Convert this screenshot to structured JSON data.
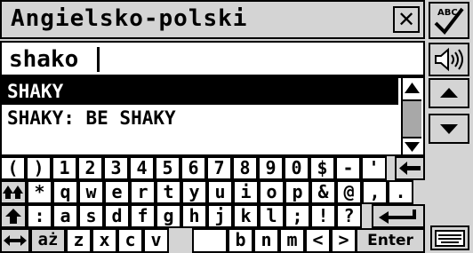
{
  "title": "Angielsko-polski",
  "search": {
    "value": "shako"
  },
  "results": [
    "SHAKY",
    "SHAKY: BE SHAKY"
  ],
  "keyboard": {
    "row1": [
      "(",
      ")",
      "1",
      "2",
      "3",
      "4",
      "5",
      "6",
      "7",
      "8",
      "9",
      "0",
      "$",
      "-",
      "'"
    ],
    "row2": [
      "*",
      "q",
      "w",
      "e",
      "r",
      "t",
      "y",
      "u",
      "i",
      "o",
      "p",
      "&",
      "@",
      ",",
      "."
    ],
    "row3": [
      ":",
      "a",
      "s",
      "d",
      "f",
      "g",
      "h",
      "j",
      "k",
      "l",
      ";",
      "!",
      "?"
    ],
    "row4": [
      "z",
      "x",
      "c",
      "v",
      "b",
      "n",
      "m",
      "<",
      ">"
    ],
    "accent_key": "aż",
    "enter_label": "Enter"
  },
  "icons": {
    "close": "close-icon",
    "spell": "spellcheck-icon",
    "speak": "speaker-icon",
    "up": "arrow-up-icon",
    "down": "arrow-down-icon",
    "keyboard": "keyboard-icon"
  },
  "colors": {
    "selection": "#000000",
    "background": "#d4d4d4"
  }
}
